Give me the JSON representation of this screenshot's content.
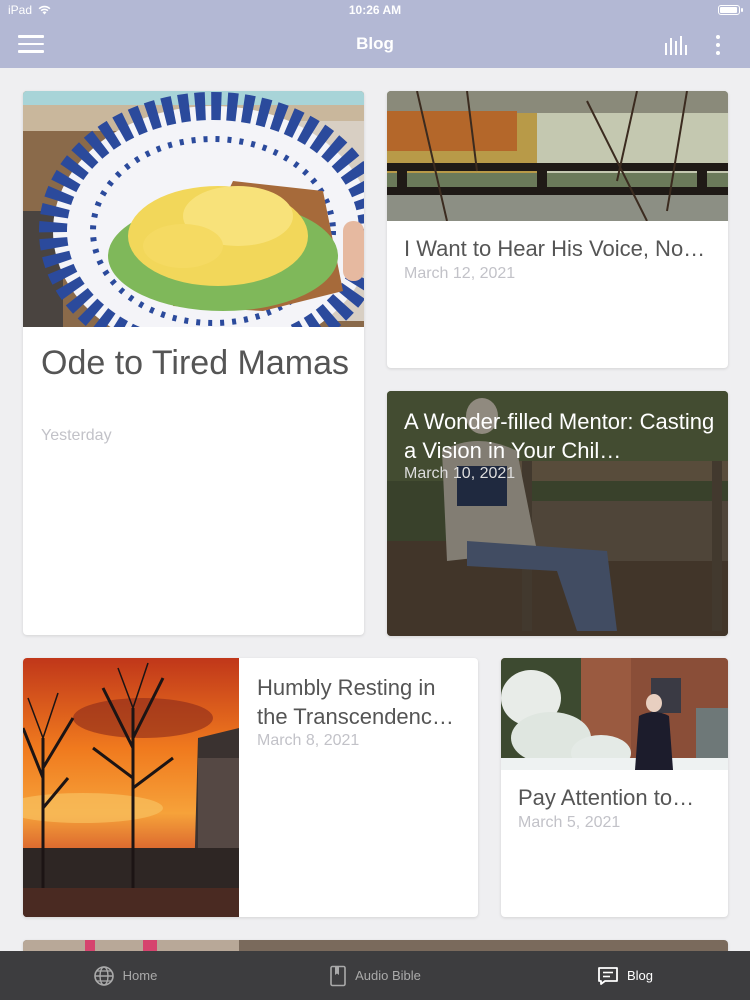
{
  "status_bar": {
    "device": "iPad",
    "time": "10:26 AM",
    "icons": [
      "wifi-icon",
      "battery-icon"
    ]
  },
  "nav_bar": {
    "title": "Blog",
    "left_icon": "hamburger-menu-icon",
    "right_icons": [
      "bar-chart-icon",
      "more-vertical-icon"
    ]
  },
  "posts": [
    {
      "title": "Ode to Tired Mamas",
      "date": "Yesterday"
    },
    {
      "title": "I Want to Hear His Voice, No…",
      "date": "March 12, 2021"
    },
    {
      "title": "A Wonder-filled Mentor: Casting a Vision in Your Chil…",
      "date": "March 10, 2021"
    },
    {
      "title": "Humbly Resting in the Transcendenc…",
      "date": "March 8, 2021"
    },
    {
      "title": "Pay Attention to…",
      "date": "March 5, 2021"
    }
  ],
  "tab_bar": {
    "tabs": [
      {
        "label": "Home",
        "icon": "globe-icon",
        "active": false
      },
      {
        "label": "Audio Bible",
        "icon": "book-icon",
        "active": false
      },
      {
        "label": "Blog",
        "icon": "blog-icon",
        "active": true
      }
    ]
  },
  "colors": {
    "nav_bg": "#b3b8d4",
    "page_bg": "#efeff1",
    "tab_bar_bg": "#3d3d3f",
    "title_text": "#555555",
    "date_text": "#c2c2c8"
  }
}
